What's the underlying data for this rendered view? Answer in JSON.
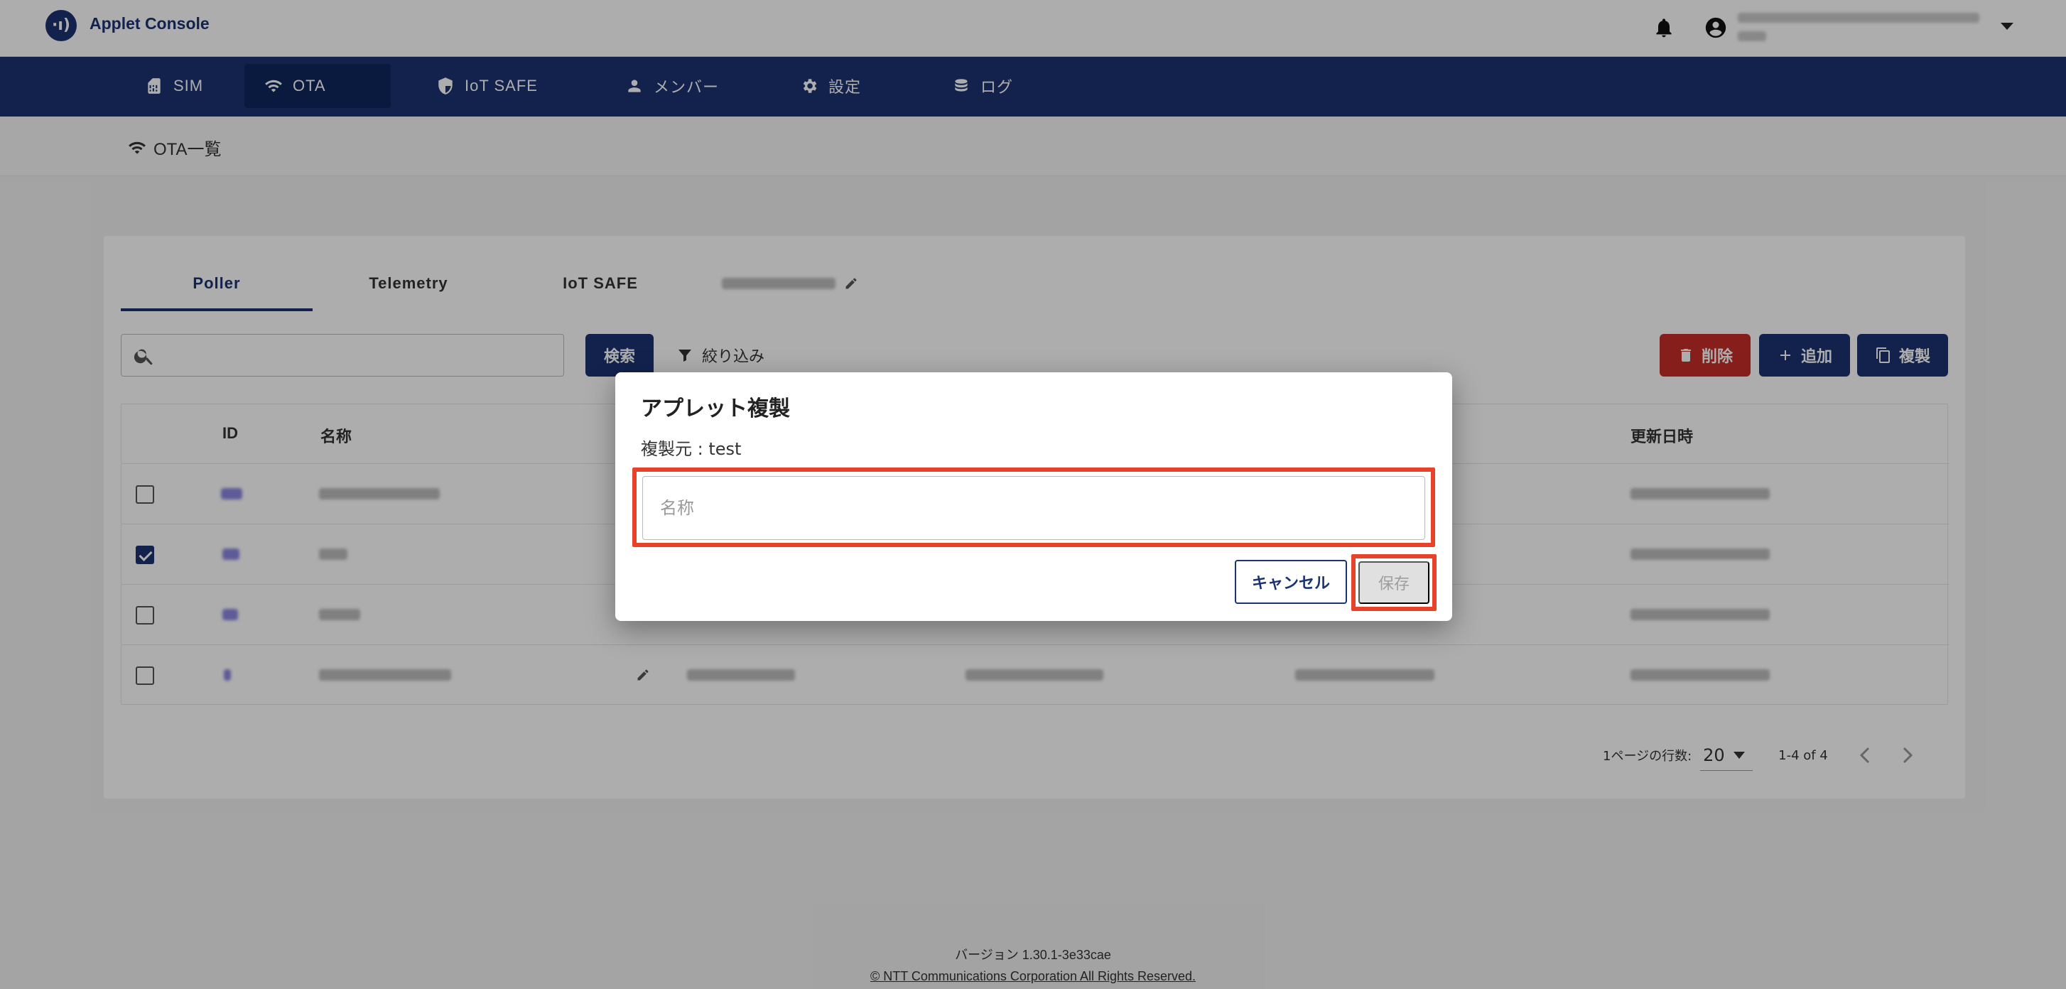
{
  "app": {
    "title": "Applet Console",
    "logo_text": "·ı)"
  },
  "nav": {
    "items": [
      {
        "label": "SIM",
        "icon": "sim-card-icon"
      },
      {
        "label": "OTA",
        "icon": "wifi-icon"
      },
      {
        "label": "IoT SAFE",
        "icon": "shield-icon"
      },
      {
        "label": "メンバー",
        "icon": "person-icon"
      },
      {
        "label": "設定",
        "icon": "gear-icon"
      },
      {
        "label": "ログ",
        "icon": "database-icon"
      }
    ],
    "active": "OTA"
  },
  "breadcrumb": {
    "label": "OTA一覧",
    "icon": "wifi-icon"
  },
  "tabs": {
    "items": [
      "Poller",
      "Telemetry",
      "IoT SAFE"
    ],
    "active": "Poller"
  },
  "toolbar": {
    "search_placeholder": "",
    "search_label": "検索",
    "filter_label": "絞り込み",
    "delete_label": "削除",
    "add_label": "追加",
    "copy_label": "複製"
  },
  "table": {
    "columns": [
      "ID",
      "名称",
      "更新日時"
    ],
    "rows": [
      {
        "checked": false
      },
      {
        "checked": true
      },
      {
        "checked": false
      },
      {
        "checked": false
      }
    ]
  },
  "pagination": {
    "rows_per_page_label": "1ページの行数:",
    "rows_per_page": "20",
    "range": "1-4 of 4"
  },
  "footer": {
    "version": "バージョン 1.30.1-3e33cae",
    "copyright": "© NTT Communications Corporation All Rights Reserved."
  },
  "dialog": {
    "title": "アプレット複製",
    "source": "複製元 : test",
    "name_placeholder": "名称",
    "name_value": "",
    "cancel_label": "キャンセル",
    "save_label": "保存"
  },
  "colors": {
    "brand": "#1b3372",
    "danger": "#c62f2a",
    "highlight": "#e8432a"
  }
}
